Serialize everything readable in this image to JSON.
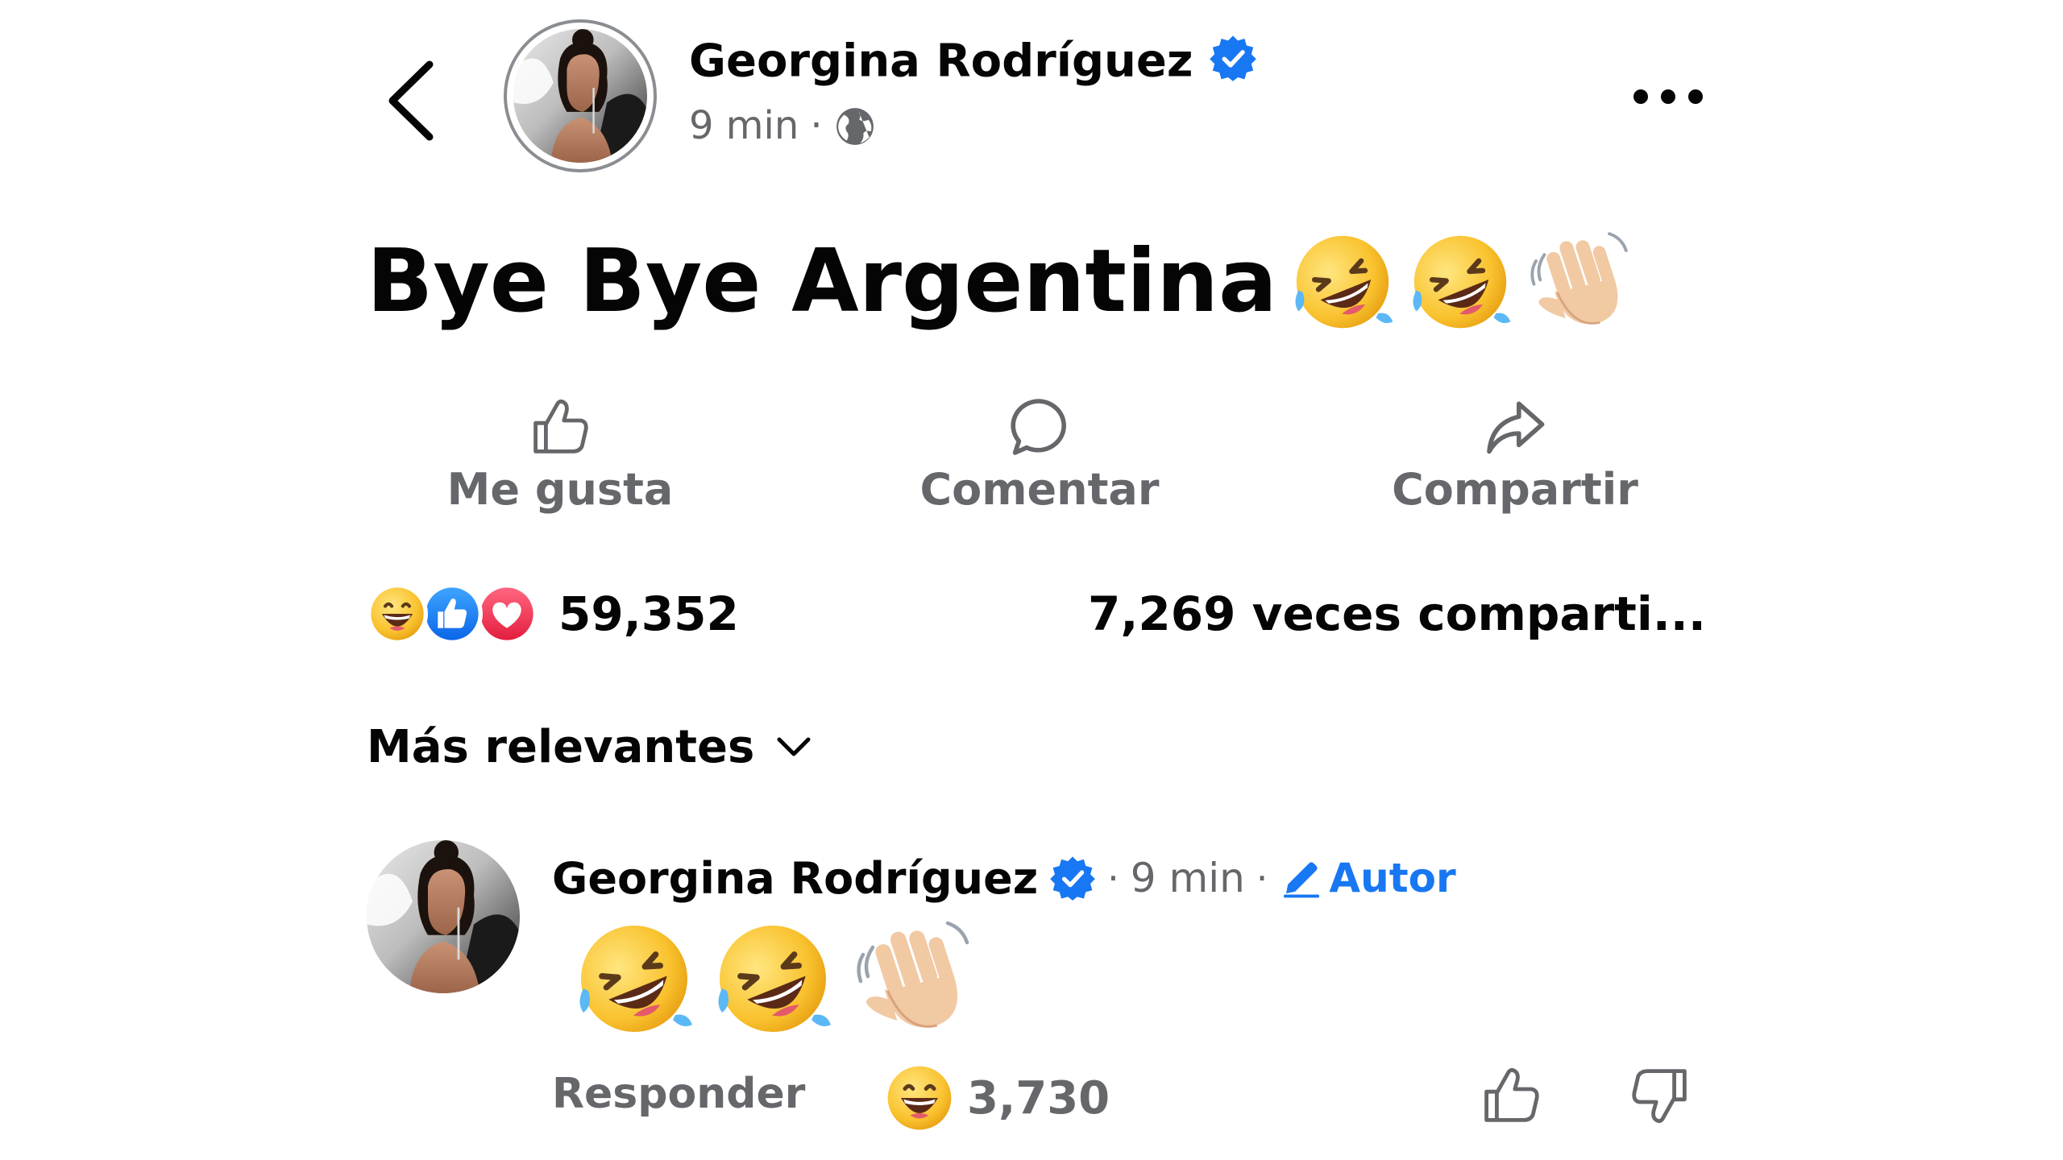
{
  "post": {
    "author": "Georgina Rodríguez",
    "time": "9 min",
    "separator": "·",
    "text": "Bye Bye Argentina",
    "text_emojis": [
      "rolling-on-floor-laughing",
      "rolling-on-floor-laughing",
      "waving-hand"
    ]
  },
  "actions": {
    "like": "Me gusta",
    "comment": "Comentar",
    "share": "Compartir"
  },
  "stats": {
    "reaction_icons": [
      "haha-reaction",
      "like-reaction",
      "love-reaction"
    ],
    "reactions_count": "59,352",
    "shares": "7,269 veces comparti..."
  },
  "sort": {
    "label": "Más relevantes"
  },
  "comment": {
    "author": "Georgina Rodríguez",
    "separator": "·",
    "time": "9 min",
    "badge": "Autor",
    "body_emojis": [
      "rolling-on-floor-laughing",
      "rolling-on-floor-laughing",
      "waving-hand"
    ],
    "reply": "Responder",
    "reactions_count": "3,730"
  },
  "colors": {
    "verified": "#1877f2",
    "secondary_text": "#65676b",
    "primary_text": "#050505",
    "author_badge": "#1877f2",
    "love": "#f33e58",
    "like": "#1877f2",
    "haha": "#f7b928"
  }
}
